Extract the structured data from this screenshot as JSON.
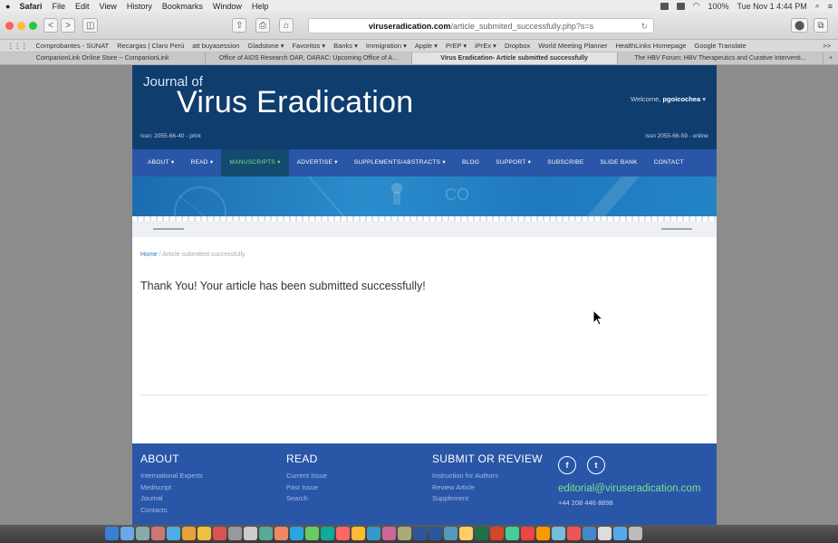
{
  "menubar": {
    "app": "Safari",
    "items": [
      "File",
      "Edit",
      "View",
      "History",
      "Bookmarks",
      "Window",
      "Help"
    ],
    "battery": "100%",
    "datetime": "Tue Nov 1 4:44 PM"
  },
  "toolbar": {
    "back": "<",
    "forward": ">",
    "sidebar": "◫",
    "share": "⇧",
    "print": "⎙",
    "home": "⌂",
    "url_domain": "viruseradication.com",
    "url_path": "/article_submited_successfully.php?s=s",
    "reload": "↻",
    "extension": "⬤",
    "tabs_overview": "⧉"
  },
  "bookmarks": [
    "Comprobantes - SUNAT",
    "Recargas | Claro Perú",
    "att buyasession",
    "Gladstone ▾",
    "Favoritos ▾",
    "Banks ▾",
    "Immigration ▾",
    "Apple ▾",
    "PrEP ▾",
    "iPrEx ▾",
    "Dropbox",
    "World Meeting Planner",
    "HealthLinks Homepage",
    "Google Translate"
  ],
  "bookmarks_more": ">>",
  "tabs": [
    {
      "label": "CompanionLink Online Store -- CompanionLink",
      "active": false
    },
    {
      "label": "Office of AIDS Research OAR, OARAC: Upcoming Office of A...",
      "active": false
    },
    {
      "label": "Virus Eradication- Article submitted successfully",
      "active": true
    },
    {
      "label": "The HBV Forum: HBV Therapeutics and Curative Interventi...",
      "active": false
    }
  ],
  "new_tab": "+",
  "site": {
    "journal_of": "Journal of",
    "journal_name": "Virus Eradication",
    "welcome_prefix": "Welcome, ",
    "username": "pgoicochea",
    "welcome_caret": "▾",
    "issn_print": "issn: 2055-66-40 - print",
    "issn_online": "issn 2055-66-59 - online",
    "nav": [
      {
        "label": "ABOUT ▾",
        "active": false
      },
      {
        "label": "READ ▾",
        "active": false
      },
      {
        "label": "MANUSCRIPTS ▾",
        "active": true
      },
      {
        "label": "ADVERTISE ▾",
        "active": false
      },
      {
        "label": "SUPPLEMENTS/ABSTRACTS ▾",
        "active": false
      },
      {
        "label": "BLOG",
        "active": false
      },
      {
        "label": "SUPPORT ▾",
        "active": false
      },
      {
        "label": "SUBSCRIBE",
        "active": false
      },
      {
        "label": "SLIDE BANK",
        "active": false
      },
      {
        "label": "CONTACT",
        "active": false
      }
    ],
    "banner_text": "CO",
    "breadcrumb_home": "Home",
    "breadcrumb_sep": "/",
    "breadcrumb_current": "Article submitted successfully",
    "message": "Thank You! Your article has been submitted successfully!",
    "footer": {
      "about_title": "ABOUT",
      "about_links": [
        "International Experts",
        "Mediscript",
        "Journal",
        "Contacts"
      ],
      "read_title": "READ",
      "read_links": [
        "Current Issue",
        "Past Issue",
        "Search"
      ],
      "submit_title": "SUBMIT OR REVIEW",
      "submit_links": [
        "Instruction for Authors",
        "Review Article",
        "Supplement"
      ],
      "facebook": "f",
      "twitter": "t",
      "email": "editorial@viruseradication.com",
      "phone": "+44 208 446 8898"
    }
  },
  "colors": {
    "masthead": "#0f3d6e",
    "nav": "#2a56a8",
    "nav_active_text": "#7ee08c",
    "link": "#2a7bc0"
  }
}
